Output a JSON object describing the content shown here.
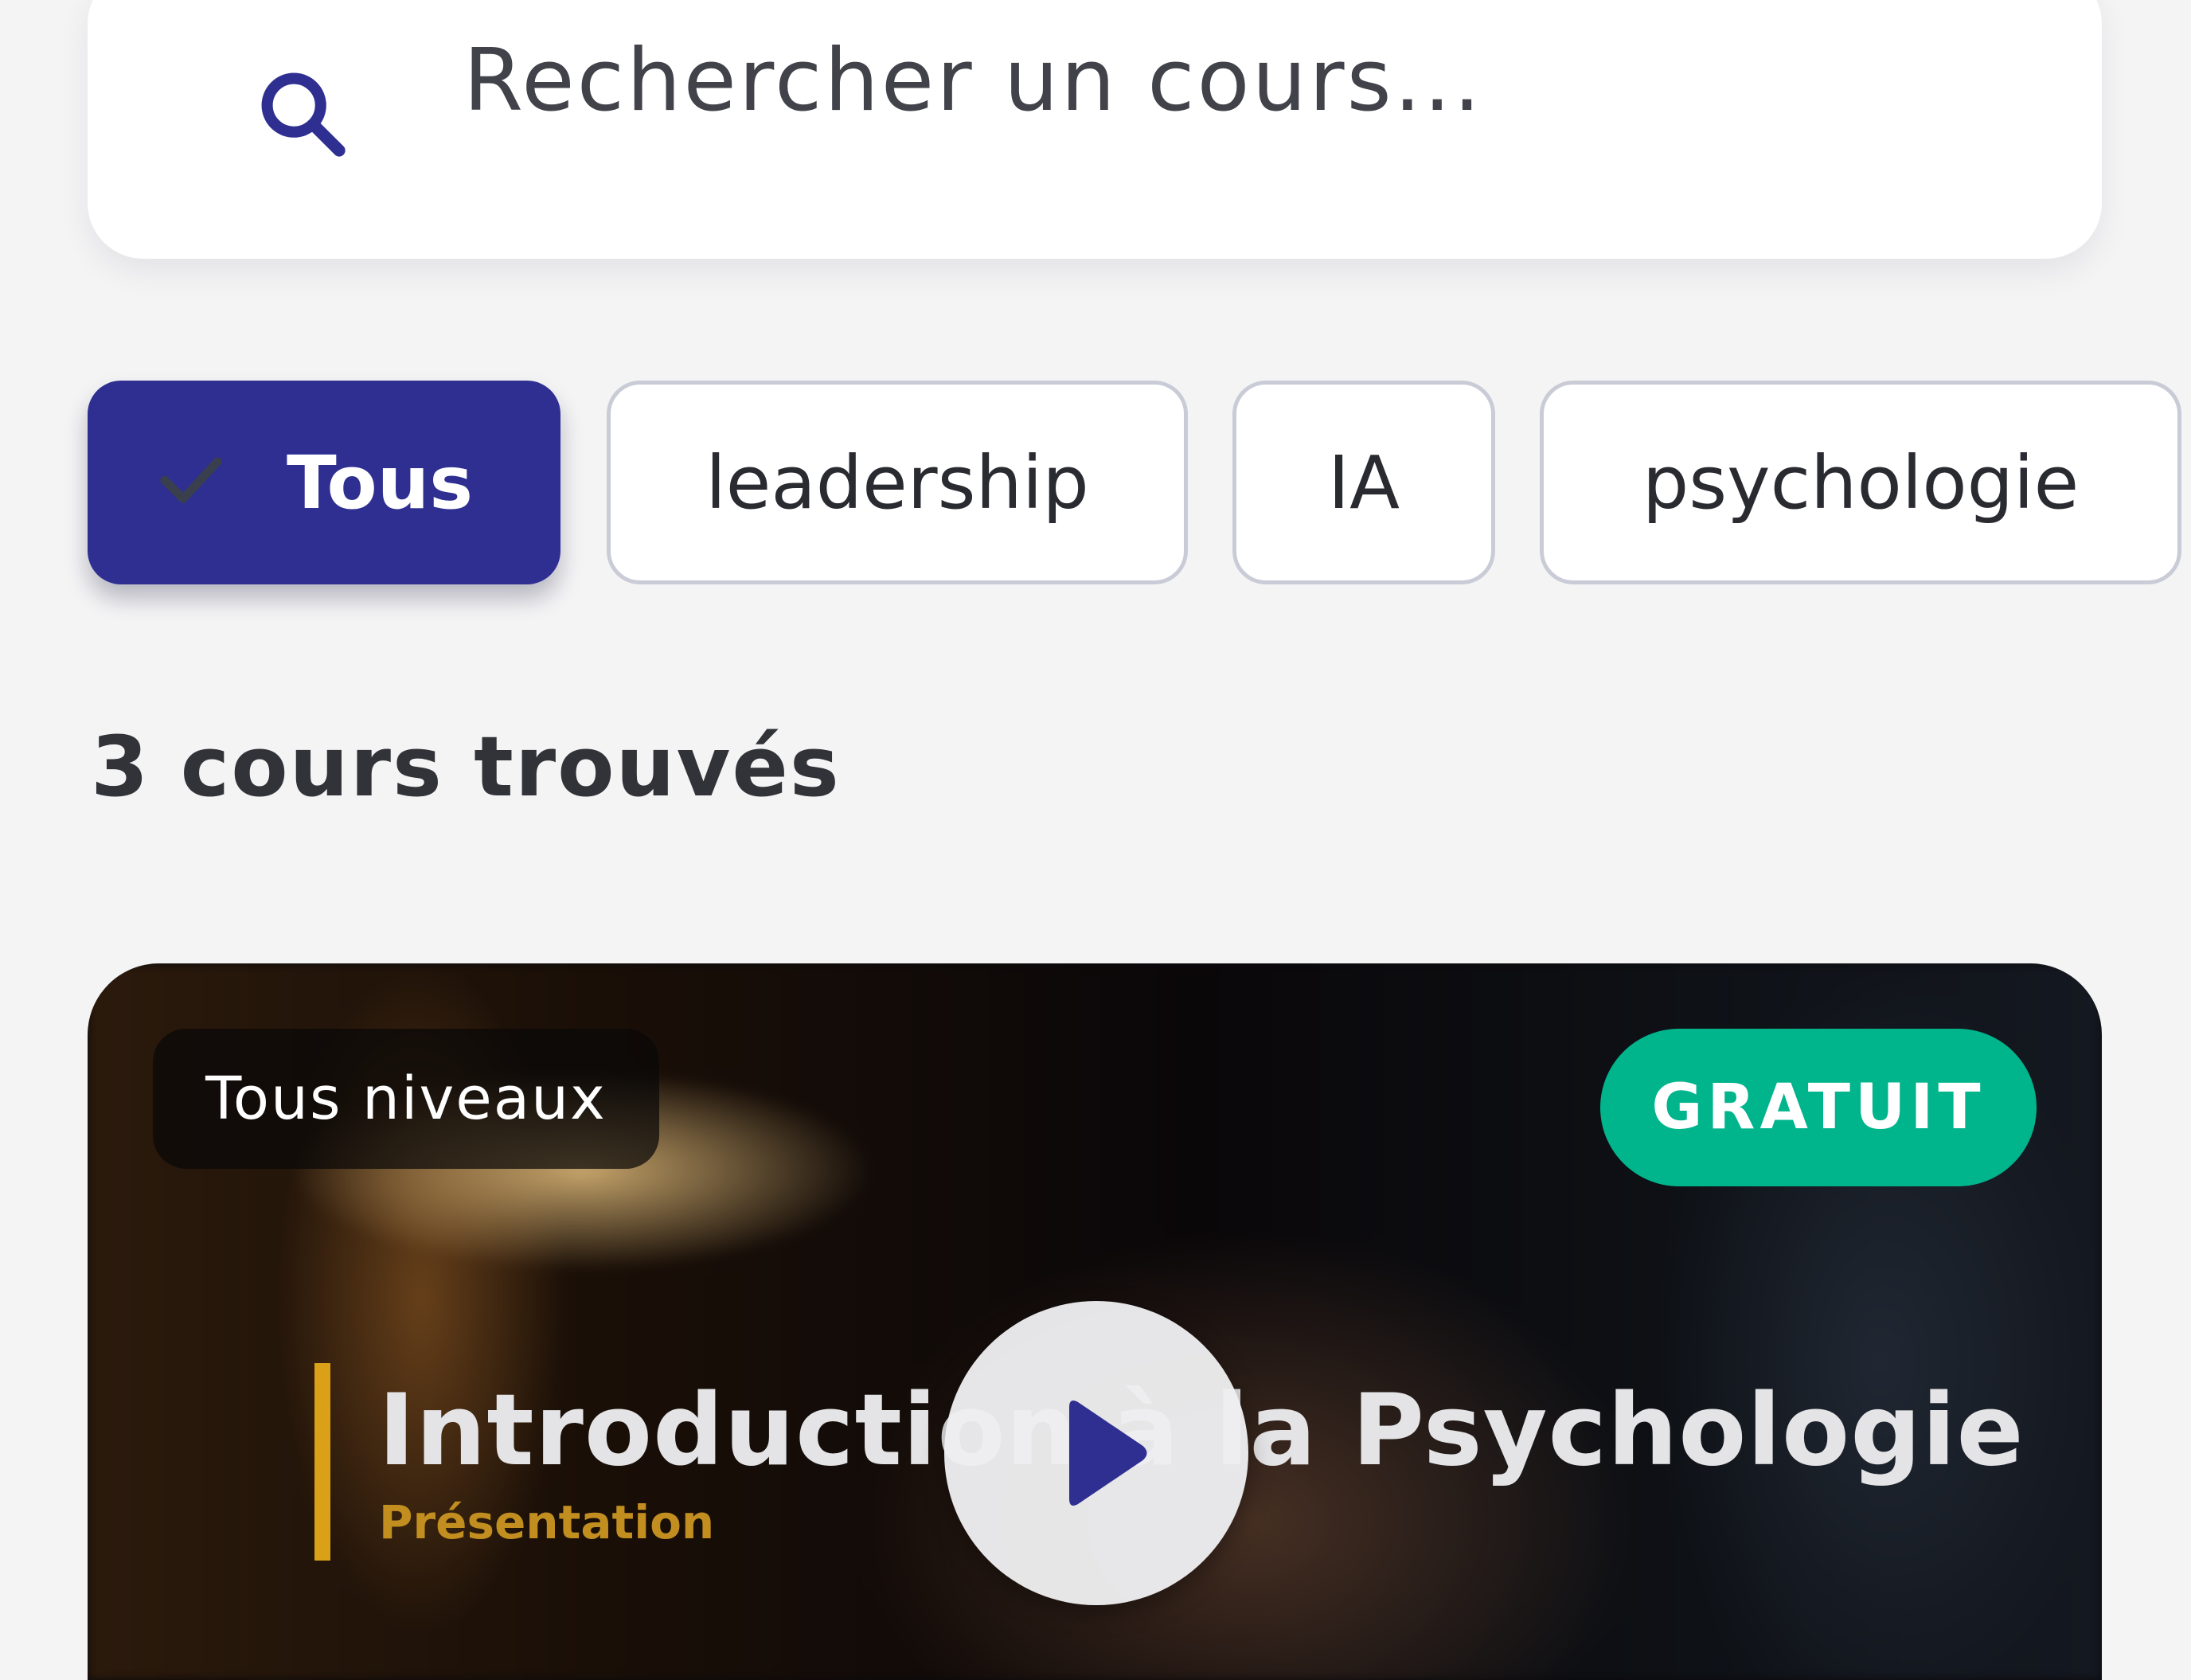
{
  "search": {
    "placeholder": "Rechercher un cours..."
  },
  "filters": {
    "chips": [
      {
        "label": "Tous",
        "selected": true
      },
      {
        "label": "leadership",
        "selected": false
      },
      {
        "label": "IA",
        "selected": false
      },
      {
        "label": "psychologie",
        "selected": false
      }
    ]
  },
  "results": {
    "count_text": "3 cours trouvés"
  },
  "course": {
    "level": "Tous niveaux",
    "price": "GRATUIT",
    "thumbnail_title": "Introduction à la Psychologie",
    "thumbnail_subtitle": "Présentation",
    "play_icon": "play-icon"
  },
  "colors": {
    "primary": "#2e2f91",
    "free_badge": "#00b48c",
    "accent_gold": "#d9a018",
    "background": "#f4f4f5"
  }
}
